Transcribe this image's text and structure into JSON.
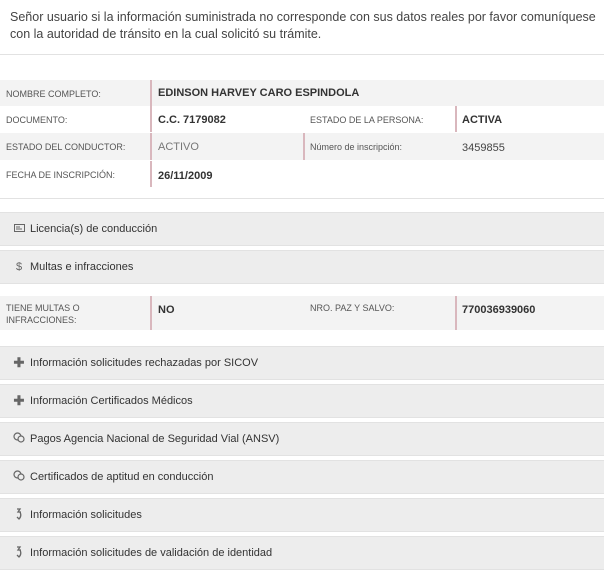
{
  "notice": "Señor usuario si la información suministrada no corresponde con sus datos reales por favor comuníquese con la autoridad de tránsito en la cual solicitó su trámite.",
  "person": {
    "nombre_label": "NOMBRE COMPLETO:",
    "nombre_value": "EDINSON HARVEY CARO ESPINDOLA",
    "documento_label": "DOCUMENTO:",
    "documento_value": "C.C. 7179082",
    "estado_persona_label": "ESTADO DE LA PERSONA:",
    "estado_persona_value": "ACTIVA",
    "estado_conductor_label": "ESTADO DEL CONDUCTOR:",
    "estado_conductor_value": "ACTIVO",
    "inscripcion_num_label": "Número de inscripción:",
    "inscripcion_num_value": "3459855",
    "fecha_label": "FECHA DE INSCRIPCIÓN:",
    "fecha_value": "26/11/2009"
  },
  "sections": {
    "licencias": "Licencia(s) de conducción",
    "multas": "Multas e infracciones",
    "rechazadas": "Información solicitudes rechazadas por SICOV",
    "medicos": "Información Certificados Médicos",
    "ansv": "Pagos Agencia Nacional de Seguridad Vial (ANSV)",
    "aptitud": "Certificados de aptitud en conducción",
    "solicitudes": "Información solicitudes",
    "validacion": "Información solicitudes de validación de identidad"
  },
  "multas": {
    "tiene_label": "TIENE MULTAS O INFRACCIONES:",
    "tiene_value": "NO",
    "paz_label": "NRO. PAZ Y SALVO:",
    "paz_value": "770036939060"
  },
  "icons": {
    "licencias": "id-card-icon",
    "multas": "dollar-icon",
    "rechazadas": "plus-icon",
    "medicos": "plus-icon",
    "ansv": "coins-icon",
    "aptitud": "coins-icon",
    "solicitudes": "hook-arrow-icon",
    "validacion": "hook-arrow-icon"
  }
}
